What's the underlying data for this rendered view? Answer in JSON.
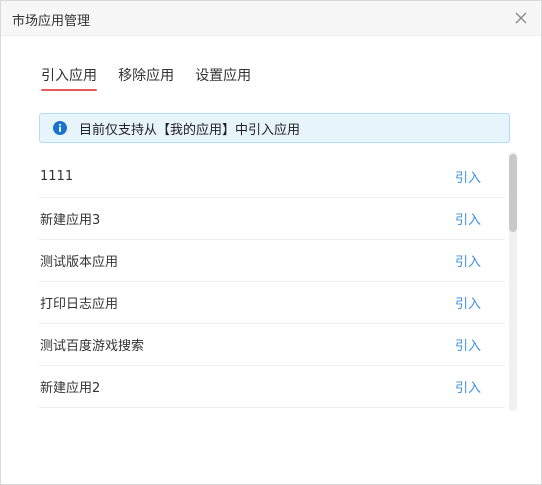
{
  "dialog": {
    "title": "市场应用管理",
    "close_icon": "close-icon"
  },
  "tabs": [
    {
      "label": "引入应用",
      "active": true
    },
    {
      "label": "移除应用",
      "active": false
    },
    {
      "label": "设置应用",
      "active": false
    }
  ],
  "notice": {
    "icon": "info-icon",
    "text": "目前仅支持从【我的应用】中引入应用"
  },
  "apps": [
    {
      "name": "1111",
      "action": "引入"
    },
    {
      "name": "新建应用3",
      "action": "引入"
    },
    {
      "name": "测试版本应用",
      "action": "引入"
    },
    {
      "name": "打印日志应用",
      "action": "引入"
    },
    {
      "name": "测试百度游戏搜索",
      "action": "引入"
    },
    {
      "name": "新建应用2",
      "action": "引入"
    }
  ],
  "colors": {
    "tab_underline": "#e85a5a",
    "link": "#3c8ee0",
    "notice_bg": "#e7f4fb",
    "info_icon": "#1a73c8"
  }
}
